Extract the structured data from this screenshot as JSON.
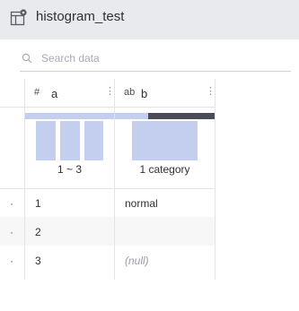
{
  "titlebar": {
    "title": "histogram_test",
    "icon": "table-settings-icon"
  },
  "search": {
    "placeholder": "Search data",
    "value": ""
  },
  "columns": [
    {
      "type_icon": "#",
      "name": "a",
      "summary": "1 ~ 3",
      "histogram_bins": 3,
      "bar_fill_fraction": 0.47
    },
    {
      "type_icon": "ab",
      "name": "b",
      "summary": "1 category",
      "categories": 1,
      "missing_fraction": 0.67
    }
  ],
  "rows": [
    {
      "marker": "·",
      "a": "1",
      "b": "normal",
      "b_null": false
    },
    {
      "marker": "·",
      "a": "2",
      "b": "",
      "b_null": false
    },
    {
      "marker": "·",
      "a": "3",
      "b": "(null)",
      "b_null": true
    }
  ],
  "colors": {
    "titlebar_bg": "#e9eaee",
    "histogram_bar": "#c4cff0",
    "valid_bar": "#c4cff0",
    "missing_bar": "#4a4d57",
    "gridline": "#e3e4e8"
  }
}
